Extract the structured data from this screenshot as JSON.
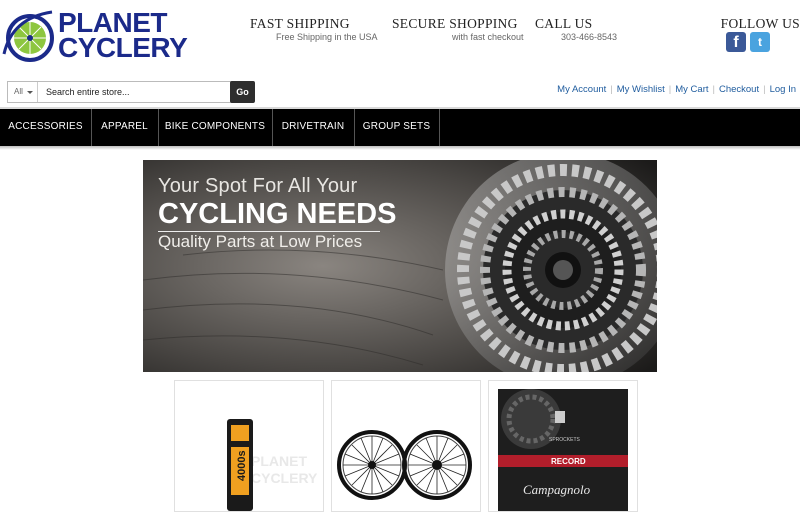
{
  "brand": {
    "line1": "PLANET",
    "line2": "CYCLERY"
  },
  "header": {
    "shipping_title": "FAST SHIPPING",
    "shipping_sub": "Free Shipping in the USA",
    "secure_title": "SECURE SHOPPING",
    "secure_sub": "with fast checkout",
    "call_title": "CALL US",
    "call_sub": "303-466-8543",
    "follow_title": "FOLLOW US",
    "facebook_icon": "facebook-icon",
    "twitter_icon": "twitter-icon"
  },
  "search": {
    "category": "All",
    "placeholder": "Search entire store...",
    "go_label": "Go"
  },
  "account": {
    "links": [
      "My Account",
      "My Wishlist",
      "My Cart",
      "Checkout",
      "Log In"
    ]
  },
  "nav": {
    "items": [
      "ACCESSORIES",
      "APPAREL",
      "BIKE COMPONENTS",
      "DRIVETRAIN",
      "GROUP SETS"
    ]
  },
  "banner": {
    "line1": "Your Spot For All Your",
    "line2": "CYCLING NEEDS",
    "line3": "Quality Parts at Low Prices"
  },
  "products": {
    "tire_brand": "4000s",
    "tile1_watermark_l1": "PLANET",
    "tile1_watermark_l2": "CYCLERY",
    "box_label": "SPROCKETS",
    "box_brand": "Campagnolo",
    "box_model": "RECORD"
  },
  "colors": {
    "brand_blue": "#1b2a8a",
    "brand_green": "#8dc63f",
    "link_blue": "#1f5c9e",
    "nav_bg": "#000000",
    "facebook": "#3b5998",
    "twitter": "#4aa3df"
  }
}
